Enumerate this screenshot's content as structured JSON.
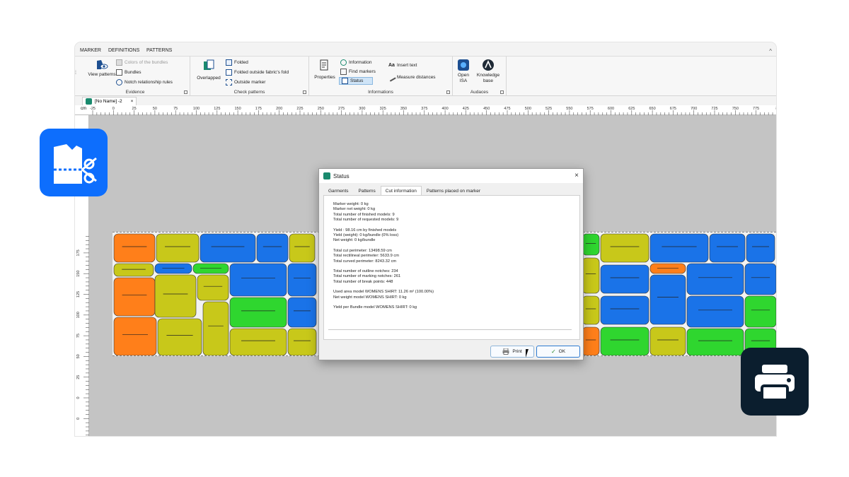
{
  "menubar": {
    "items": [
      "MARKER",
      "DEFINITIONS",
      "PATTERNS"
    ],
    "collapse": "^"
  },
  "ribbon": {
    "evidence": {
      "label": "Evidence",
      "view_patterns": "View patterns",
      "colors_of_bundles": "Colors of the bundles",
      "bundles": "Bundles",
      "notch_rules": "Notch relationship rules"
    },
    "check_patterns": {
      "label": "Check patterns",
      "overlapped": "Overlapped",
      "folded": "Folded",
      "folded_outside": "Folded outside fabric's fold",
      "outside_marker": "Outside marker"
    },
    "informations": {
      "label": "Informations",
      "properties": "Properties",
      "information": "Information",
      "find_markers": "Find markers",
      "status": "Status",
      "insert_text": "Insert text",
      "measure_distances": "Measure distances"
    },
    "audaces": {
      "label": "Audaces",
      "open_isa": "Open ISA",
      "knowledge_base": "Knowledge base"
    }
  },
  "doc_tab": {
    "title": "[No Name] -2",
    "close": "×"
  },
  "ruler": {
    "unit": "cm",
    "h_ticks": [
      "-25",
      "0",
      "25",
      "50",
      "75",
      "100",
      "125",
      "150",
      "175",
      "200",
      "225",
      "250",
      "275",
      "300",
      "325",
      "350",
      "375",
      "400",
      "425",
      "450",
      "475",
      "500",
      "525",
      "550",
      "575",
      "600",
      "625",
      "650",
      "675",
      "700",
      "725",
      "750",
      "775",
      "8"
    ],
    "v_ticks": [
      "0",
      "25",
      "50",
      "75",
      "100",
      "125",
      "150",
      "175",
      "0",
      "25",
      "50",
      "75"
    ]
  },
  "dialog": {
    "title": "Status",
    "close": "×",
    "tabs": [
      "Garments",
      "Patterns",
      "Cut information",
      "Patterns placed on marker"
    ],
    "active_tab": "Cut information",
    "lines": [
      "Marker weight: 0 kg",
      "Marker net weight: 0 kg",
      "Total number of finished models: 9",
      "Total number of requested models: 9",
      "",
      "Yield : 98.16 cm by finished models",
      "Yield (weight): 0 kg/bundle (0% loss)",
      "Net weight: 0 kg/bundle",
      "",
      "Total cut perimeter: 13498.59 cm",
      "Total rectilineal perimeter: 5633.9 cm",
      "Total curved perimeter: 8243.32 cm",
      "",
      "Total number of outline notches: 234",
      "Total number of marking notches: 261",
      "Total number of break points: 448",
      "",
      "Used area model WOMENS SHIRT: 11.26 m² (100.00%)",
      "Net weight model WOMENS SHIRT: 0 kg",
      "",
      "Yield per Bundle model WOMENS SHIRT: 0 kg"
    ],
    "print_button": "Print",
    "ok_button": "OK"
  },
  "colors": {
    "accent_blue": "#0d6efd",
    "dark_badge": "#0b1e2e",
    "piece_orange": "#ff7f1a",
    "piece_yellow": "#c8c81a",
    "piece_blue": "#1a73e8",
    "piece_green": "#2fd62f"
  },
  "icons": {
    "left_badge": "pattern-cut-icon",
    "right_badge": "printer-icon"
  }
}
